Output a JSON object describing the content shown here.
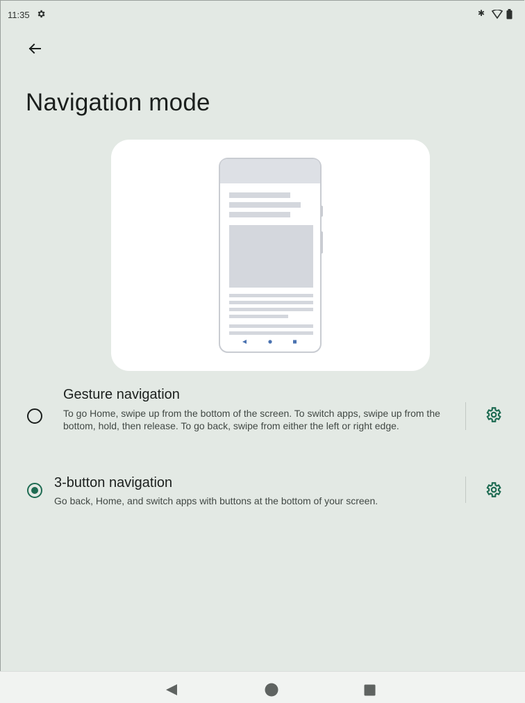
{
  "status_bar": {
    "time": "11:35",
    "icons": [
      "settings-icon",
      "bluetooth-icon",
      "wifi-icon",
      "battery-icon"
    ]
  },
  "header": {
    "title": "Navigation mode",
    "back_icon": "arrow-back-icon"
  },
  "options": [
    {
      "title": "Gesture navigation",
      "description": "To go Home, swipe up from the bottom of the screen. To switch apps, swipe up from the bottom, hold, then release. To go back, swipe from either the left or right edge.",
      "selected": false
    },
    {
      "title": "3-button navigation",
      "description": "Go back, Home, and switch apps with buttons at the bottom of your screen.",
      "selected": true
    }
  ],
  "system_nav": {
    "buttons": [
      "back-triangle-icon",
      "home-circle-icon",
      "recents-square-icon"
    ]
  },
  "colors": {
    "background": "#e3e9e4",
    "accent": "#1e6b52",
    "card": "#ffffff"
  }
}
